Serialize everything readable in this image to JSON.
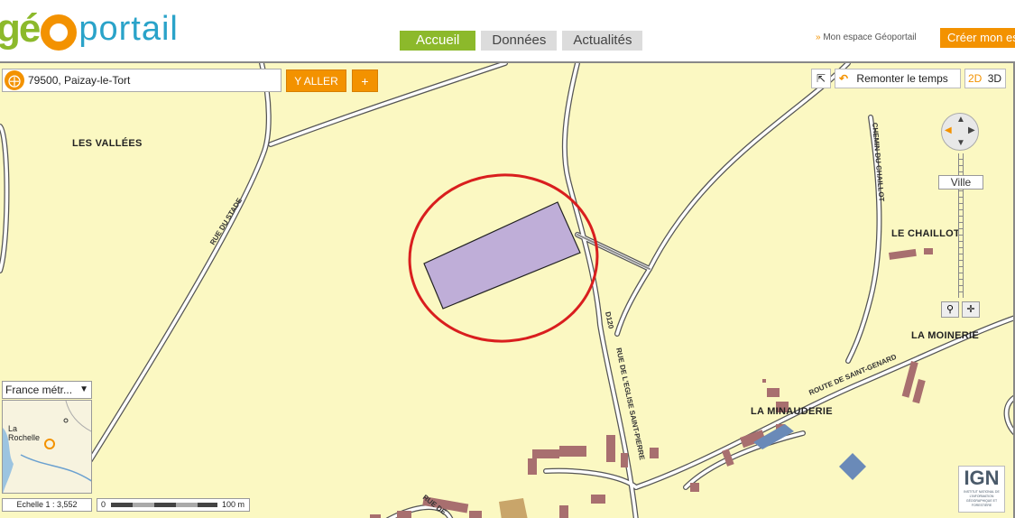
{
  "header": {
    "logo_part1": "gé",
    "logo_part2": "portail",
    "nav_tabs": [
      "Accueil",
      "Données",
      "Actualités"
    ],
    "mon_espace_label": "Mon espace Géoportail",
    "mon_espace_arrow": "»",
    "creer_label": "Créer mon es"
  },
  "search": {
    "value": "79500, Paizay-le-Tort",
    "go_label": "Y ALLER",
    "plus_label": "+"
  },
  "map_controls": {
    "timeline_label": "Remonter le temps",
    "view_2d": "2D",
    "view_3d": "3D",
    "zoom_level_label": "Ville",
    "territory_label": "France métr...",
    "scale_label": "Echelle 1 : 3,552",
    "scale_zero": "0",
    "scale_distance": "100 m",
    "provider_logo": "IGN",
    "provider_text": "INSTITUT NATIONAL DE L'INFORMATION GÉOGRAPHIQUE ET FORESTIÈRE"
  },
  "places": {
    "les_vallees": "LES VALLÉES",
    "le_chaillot": "LE CHAILLOT",
    "la_moinerie": "LA MOINERIE",
    "la_minauderie": "LA MINAUDERIE"
  },
  "roads": {
    "rue_du_stade": "RUE DU STADE",
    "chemin_du_chaillot": "CHEMIN DU CHAILLOT",
    "d120": "D120",
    "rue_eglise": "RUE DE L'EGLISE SAINT-PIERRE",
    "route_saint_genard": "ROUTE DE SAINT-GENARD",
    "rue_de": "RUE DE"
  },
  "minimap": {
    "city_label": "La Rochelle"
  },
  "colors": {
    "map_background": "#fbf8c2",
    "accent_orange": "#f39200",
    "accent_green": "#8cb92b",
    "parcel_fill": "#bfaed8",
    "highlight_circle": "#d91e1e",
    "building": "#a86f6f"
  },
  "icons": {
    "search": "locate-icon",
    "fullscreen": "fullscreen-icon",
    "timeline": "undo-arrow-icon",
    "navigation": "pan-compass-icon",
    "zoom_select": "zoom-box-icon",
    "center": "crosshair-icon"
  }
}
